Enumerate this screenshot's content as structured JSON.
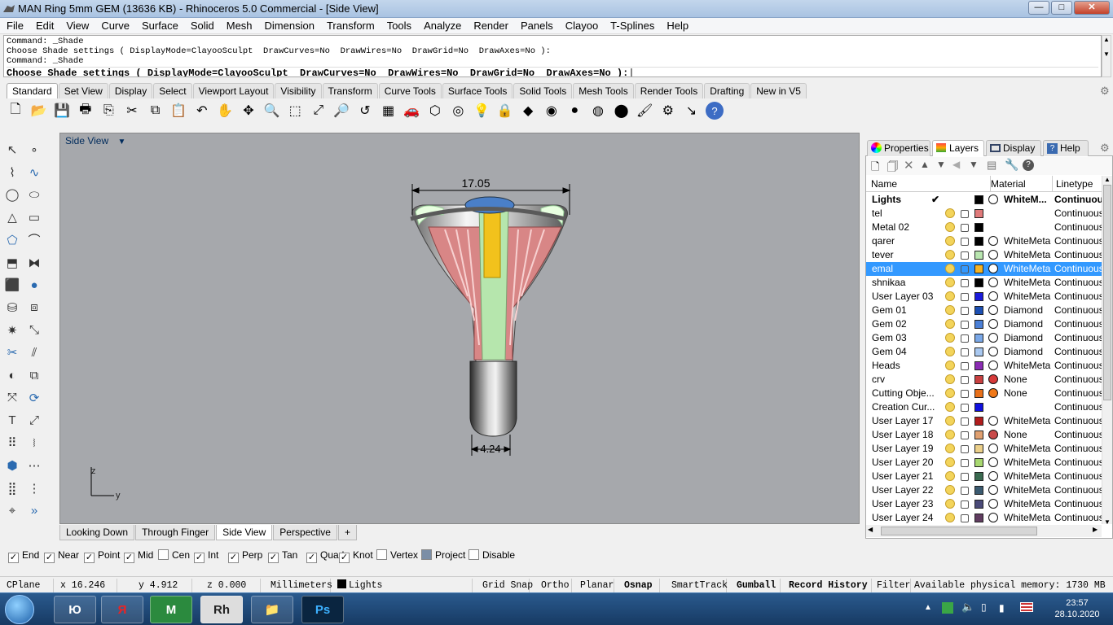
{
  "window": {
    "title": "MAN Ring 5mm GEM (13636 KB) - Rhinoceros 5.0 Commercial - [Side View]",
    "minimize": "—",
    "maximize": "□",
    "close": "✕"
  },
  "menu": [
    "File",
    "Edit",
    "View",
    "Curve",
    "Surface",
    "Solid",
    "Mesh",
    "Dimension",
    "Transform",
    "Tools",
    "Analyze",
    "Render",
    "Panels",
    "Clayoo",
    "T-Splines",
    "Help"
  ],
  "command": {
    "lines": [
      "Command: _Shade",
      "Choose Shade settings ( DisplayMode=ClayooSculpt  DrawCurves=No  DrawWires=No  DrawGrid=No  DrawAxes=No ):",
      "Command: _Shade"
    ],
    "prompt": "Choose Shade settings ( DisplayMode=ClayooSculpt  DrawCurves=No  DrawWires=No  DrawGrid=No  DrawAxes=No ):"
  },
  "toolbar_tabs": [
    "Standard",
    "Set View",
    "Display",
    "Select",
    "Viewport Layout",
    "Visibility",
    "Transform",
    "Curve Tools",
    "Surface Tools",
    "Solid Tools",
    "Mesh Tools",
    "Render Tools",
    "Drafting",
    "New in V5"
  ],
  "viewport": {
    "title": "Side View",
    "dim_top": "17.05",
    "dim_bottom": "4.24",
    "axis_z": "z",
    "axis_y": "y"
  },
  "viewport_tabs": [
    "Looking Down",
    "Through Finger",
    "Side View",
    "Perspective"
  ],
  "panel_tabs": [
    "Properties",
    "Layers",
    "Display",
    "Help"
  ],
  "layer_columns": {
    "name": "Name",
    "material": "Material",
    "linetype": "Linetype"
  },
  "layers": [
    {
      "name": "Lights",
      "color": "#000000",
      "material": "WhiteM...",
      "linetype": "Continuous",
      "current": true
    },
    {
      "name": "tel",
      "color": "#e07a7a",
      "material": "",
      "linetype": "Continuous"
    },
    {
      "name": "Metal 02",
      "color": "#000000",
      "material": "",
      "linetype": "Continuous"
    },
    {
      "name": "qarer",
      "color": "#000000",
      "material": "WhiteMetal",
      "linetype": "Continuous"
    },
    {
      "name": "tever",
      "color": "#b9e6b0",
      "material": "WhiteMetal",
      "linetype": "Continuous"
    },
    {
      "name": "emal",
      "color": "#f5b324",
      "material": "WhiteMetal",
      "linetype": "Continuous",
      "selected": true
    },
    {
      "name": "shnikaa",
      "color": "#000000",
      "material": "WhiteMetal",
      "linetype": "Continuous"
    },
    {
      "name": "User Layer 03",
      "color": "#1a1adb",
      "material": "WhiteMetal",
      "linetype": "Continuous"
    },
    {
      "name": "Gem 01",
      "color": "#1c4fb3",
      "material": "Diamond",
      "linetype": "Continuous"
    },
    {
      "name": "Gem 02",
      "color": "#4a7fd6",
      "material": "Diamond",
      "linetype": "Continuous"
    },
    {
      "name": "Gem 03",
      "color": "#7aa8e8",
      "material": "Diamond",
      "linetype": "Continuous"
    },
    {
      "name": "Gem 04",
      "color": "#a9c8f0",
      "material": "Diamond",
      "linetype": "Continuous"
    },
    {
      "name": "Heads",
      "color": "#8a2bb3",
      "material": "WhiteMetal",
      "linetype": "Continuous"
    },
    {
      "name": "crv",
      "color": "#c94040",
      "material": "None",
      "linetype": "Continuous",
      "matcolor": "#d63a3a"
    },
    {
      "name": "Cutting Obje...",
      "color": "#e8701a",
      "material": "None",
      "linetype": "Continuous",
      "matcolor": "#f07818"
    },
    {
      "name": "Creation Cur...",
      "color": "#1010e0",
      "material": "",
      "linetype": "Continuous"
    },
    {
      "name": "User Layer 17",
      "color": "#b01c1c",
      "material": "WhiteMetal",
      "linetype": "Continuous"
    },
    {
      "name": "User Layer 18",
      "color": "#e0a070",
      "material": "None",
      "linetype": "Continuous",
      "matcolor": "#c94a4a"
    },
    {
      "name": "User Layer 19",
      "color": "#ecd08a",
      "material": "WhiteMetal",
      "linetype": "Continuous"
    },
    {
      "name": "User Layer 20",
      "color": "#a8d870",
      "material": "WhiteMetal",
      "linetype": "Continuous"
    },
    {
      "name": "User Layer 21",
      "color": "#3a6a50",
      "material": "WhiteMetal",
      "linetype": "Continuous"
    },
    {
      "name": "User Layer 22",
      "color": "#3a5a70",
      "material": "WhiteMetal",
      "linetype": "Continuous"
    },
    {
      "name": "User Layer 23",
      "color": "#4a4a78",
      "material": "WhiteMetal",
      "linetype": "Continuous"
    },
    {
      "name": "User Layer 24",
      "color": "#603c60",
      "material": "WhiteMetal",
      "linetype": "Continuous"
    }
  ],
  "osnap": [
    {
      "label": "End",
      "checked": true
    },
    {
      "label": "Near",
      "checked": true
    },
    {
      "label": "Point",
      "checked": true
    },
    {
      "label": "Mid",
      "checked": true
    },
    {
      "label": "Cen",
      "checked": false
    },
    {
      "label": "Int",
      "checked": true
    },
    {
      "label": "Perp",
      "checked": true
    },
    {
      "label": "Tan",
      "checked": true
    },
    {
      "label": "Quad",
      "checked": true
    },
    {
      "label": "Knot",
      "checked": true
    },
    {
      "label": "Vertex",
      "checked": false
    },
    {
      "label": "Project",
      "checked": false
    },
    {
      "label": "Disable",
      "checked": false
    }
  ],
  "status": {
    "cplane": "CPlane",
    "x": "x 16.246",
    "y": "y 4.912",
    "z": "z 0.000",
    "units": "Millimeters",
    "layer": "Lights",
    "grid_snap": "Grid Snap",
    "ortho": "Ortho",
    "planar": "Planar",
    "osnap": "Osnap",
    "smarttrack": "SmartTrack",
    "gumball": "Gumball",
    "record_history": "Record History",
    "filter": "Filter",
    "memory": "Available physical memory: 1730 MB"
  },
  "taskbar": {
    "time": "23:57",
    "date": "28.10.2020",
    "apps": [
      "Ю",
      "Я",
      "M",
      "Rh",
      "📁",
      "Ps"
    ]
  }
}
